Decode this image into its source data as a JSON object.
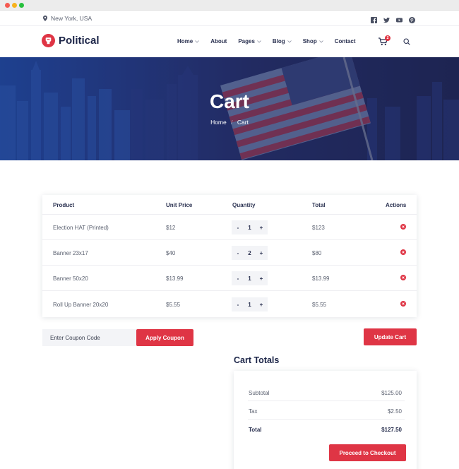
{
  "topbar": {
    "location": "New York, USA",
    "socials": [
      "facebook-icon",
      "twitter-icon",
      "youtube-icon",
      "pinterest-icon"
    ]
  },
  "brand": {
    "name": "Political",
    "accent": "#df3545",
    "navy": "#1c2548"
  },
  "nav": {
    "items": [
      {
        "label": "Home",
        "dropdown": true
      },
      {
        "label": "About",
        "dropdown": false
      },
      {
        "label": "Pages",
        "dropdown": true
      },
      {
        "label": "Blog",
        "dropdown": true
      },
      {
        "label": "Shop",
        "dropdown": true
      },
      {
        "label": "Contact",
        "dropdown": false
      }
    ],
    "cart_count": "2"
  },
  "hero": {
    "title": "Cart",
    "breadcrumb_home": "Home",
    "breadcrumb_sep": "/",
    "breadcrumb_current": "Cart"
  },
  "table": {
    "headers": {
      "product": "Product",
      "unit_price": "Unit Price",
      "quantity": "Quantity",
      "total": "Total",
      "actions": "Actions"
    },
    "rows": [
      {
        "product": "Election HAT (Printed)",
        "price": "$12",
        "qty": "1",
        "total": "$123"
      },
      {
        "product": "Banner 23x17",
        "price": "$40",
        "qty": "2",
        "total": "$80"
      },
      {
        "product": "Banner 50x20",
        "price": "$13.99",
        "qty": "1",
        "total": "$13.99"
      },
      {
        "product": "Roll Up Banner 20x20",
        "price": "$5.55",
        "qty": "1",
        "total": "$5.55"
      }
    ],
    "minus": "-",
    "plus": "+"
  },
  "coupon": {
    "placeholder": "Enter Coupon Code",
    "apply_label": "Apply Coupon",
    "update_label": "Update Cart"
  },
  "totals": {
    "title": "Cart Totals",
    "subtotal_label": "Subtotal",
    "subtotal": "$125.00",
    "tax_label": "Tax",
    "tax": "$2.50",
    "total_label": "Total",
    "total": "$127.50",
    "checkout_label": "Proceed to Checkout"
  }
}
